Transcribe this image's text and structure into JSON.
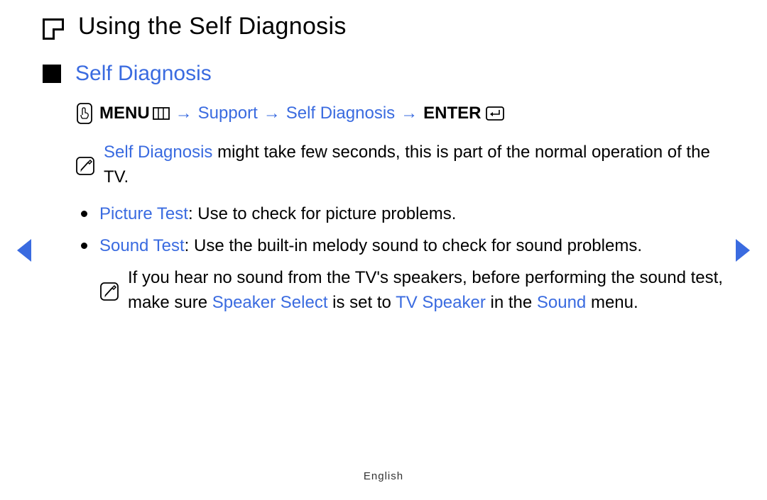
{
  "page": {
    "title": "Using the Self Diagnosis"
  },
  "section": {
    "title": "Self Diagnosis"
  },
  "nav": {
    "menu": "MENU",
    "arrow": "→",
    "support": "Support",
    "self_diag": "Self Diagnosis",
    "enter": "ENTER"
  },
  "note1": {
    "highlight": "Self Diagnosis",
    "rest": " might take few seconds, this is part of the normal operation of the TV."
  },
  "bullets": {
    "picture": {
      "label": "Picture Test",
      "desc": ": Use to check for picture problems."
    },
    "sound": {
      "label": "Sound Test",
      "desc": ": Use the built-in melody sound to check for sound problems."
    }
  },
  "subnote": {
    "part1": "If you hear no sound from the TV's speakers, before performing the sound test, make sure ",
    "speaker_select": "Speaker Select",
    "part2": " is set to ",
    "tv_speaker": "TV Speaker",
    "part3": " in the ",
    "sound_menu": "Sound",
    "part4": " menu."
  },
  "footer": {
    "language": "English"
  }
}
